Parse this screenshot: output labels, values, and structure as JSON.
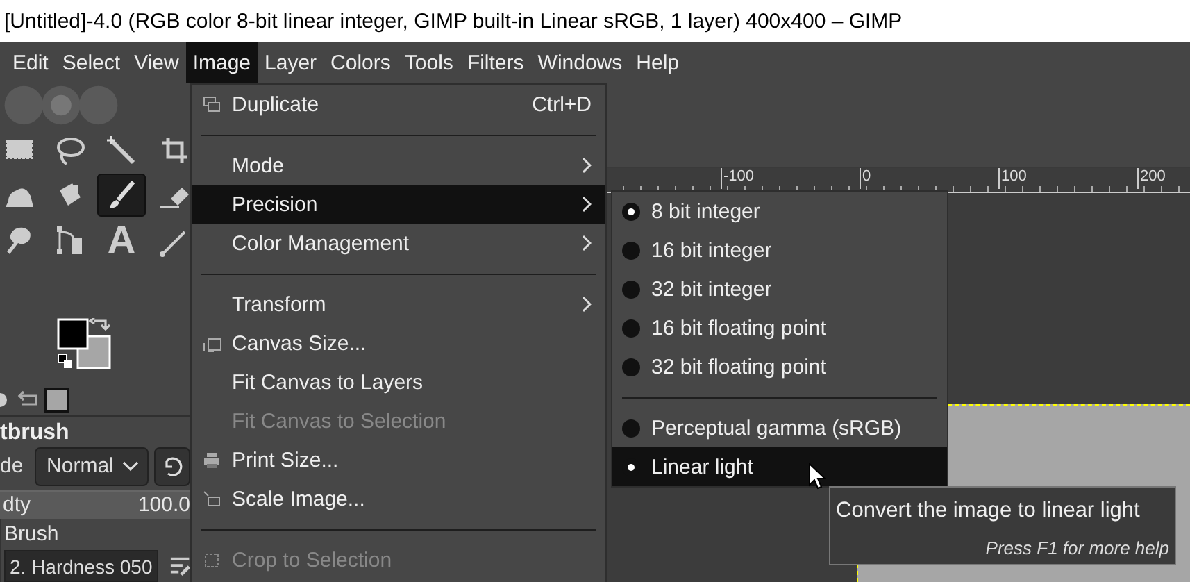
{
  "window": {
    "title": "[Untitled]-4.0 (RGB color 8-bit linear integer, GIMP built-in Linear sRGB, 1 layer) 400x400 – GIMP"
  },
  "menubar": [
    {
      "label": "Edit",
      "selected": false
    },
    {
      "label": "Select",
      "selected": false
    },
    {
      "label": "View",
      "selected": false
    },
    {
      "label": "Image",
      "selected": true
    },
    {
      "label": "Layer",
      "selected": false
    },
    {
      "label": "Colors",
      "selected": false
    },
    {
      "label": "Tools",
      "selected": false
    },
    {
      "label": "Filters",
      "selected": false
    },
    {
      "label": "Windows",
      "selected": false
    },
    {
      "label": "Help",
      "selected": false
    }
  ],
  "toolbox": {
    "tools": [
      {
        "selected": false
      },
      {
        "selected": false
      },
      {
        "selected": false
      },
      {
        "selected": false
      },
      {
        "selected": false
      },
      {
        "selected": false
      },
      {
        "selected": true
      },
      {
        "selected": false
      },
      {
        "selected": false
      },
      {
        "selected": false
      },
      {
        "glyph": "A",
        "selected": false
      },
      {
        "selected": false
      }
    ],
    "tool_options": {
      "title": "tbrush",
      "mode_label": "de",
      "mode_value": "Normal",
      "opacity": {
        "label": "dty",
        "value": "100.0",
        "level": 1
      },
      "brush_label": "Brush",
      "brush_value": "2. Hardness 050"
    }
  },
  "ruler": {
    "labels": [
      "-100",
      "0",
      "100",
      "200"
    ]
  },
  "image_menu": {
    "items": [
      {
        "kind": "item",
        "label": "Duplicate",
        "shortcut": "Ctrl+D",
        "disabled": false,
        "highlighted": false
      },
      {
        "kind": "separator"
      },
      {
        "kind": "submenu",
        "label": "Mode",
        "disabled": false,
        "highlighted": false
      },
      {
        "kind": "submenu",
        "label": "Precision",
        "disabled": false,
        "highlighted": true
      },
      {
        "kind": "submenu",
        "label": "Color Management",
        "disabled": false,
        "highlighted": false
      },
      {
        "kind": "separator"
      },
      {
        "kind": "submenu",
        "label": "Transform",
        "disabled": false,
        "highlighted": false
      },
      {
        "kind": "item",
        "label": "Canvas Size...",
        "disabled": false,
        "highlighted": false
      },
      {
        "kind": "item",
        "label": "Fit Canvas to Layers",
        "disabled": false,
        "highlighted": false
      },
      {
        "kind": "item",
        "label": "Fit Canvas to Selection",
        "disabled": true,
        "highlighted": false
      },
      {
        "kind": "item",
        "label": "Print Size...",
        "disabled": false,
        "highlighted": false
      },
      {
        "kind": "item",
        "label": "Scale Image...",
        "disabled": false,
        "highlighted": false
      },
      {
        "kind": "separator"
      },
      {
        "kind": "item",
        "label": "Crop to Selection",
        "disabled": true,
        "highlighted": false
      }
    ]
  },
  "precision_menu": {
    "items": [
      {
        "kind": "radio",
        "label": "8 bit integer",
        "selected": true,
        "highlighted": false
      },
      {
        "kind": "radio",
        "label": "16 bit integer",
        "selected": false,
        "highlighted": false
      },
      {
        "kind": "radio",
        "label": "32 bit integer",
        "selected": false,
        "highlighted": false
      },
      {
        "kind": "radio",
        "label": "16 bit floating point",
        "selected": false,
        "highlighted": false
      },
      {
        "kind": "radio",
        "label": "32 bit floating point",
        "selected": false,
        "highlighted": false
      },
      {
        "kind": "separator"
      },
      {
        "kind": "radio",
        "label": "Perceptual gamma (sRGB)",
        "selected": false,
        "highlighted": false
      },
      {
        "kind": "radio",
        "label": "Linear light",
        "selected": true,
        "highlighted": true
      }
    ]
  },
  "tooltip": {
    "text": "Convert the image to linear light",
    "hint": "Press F1 for more help"
  }
}
